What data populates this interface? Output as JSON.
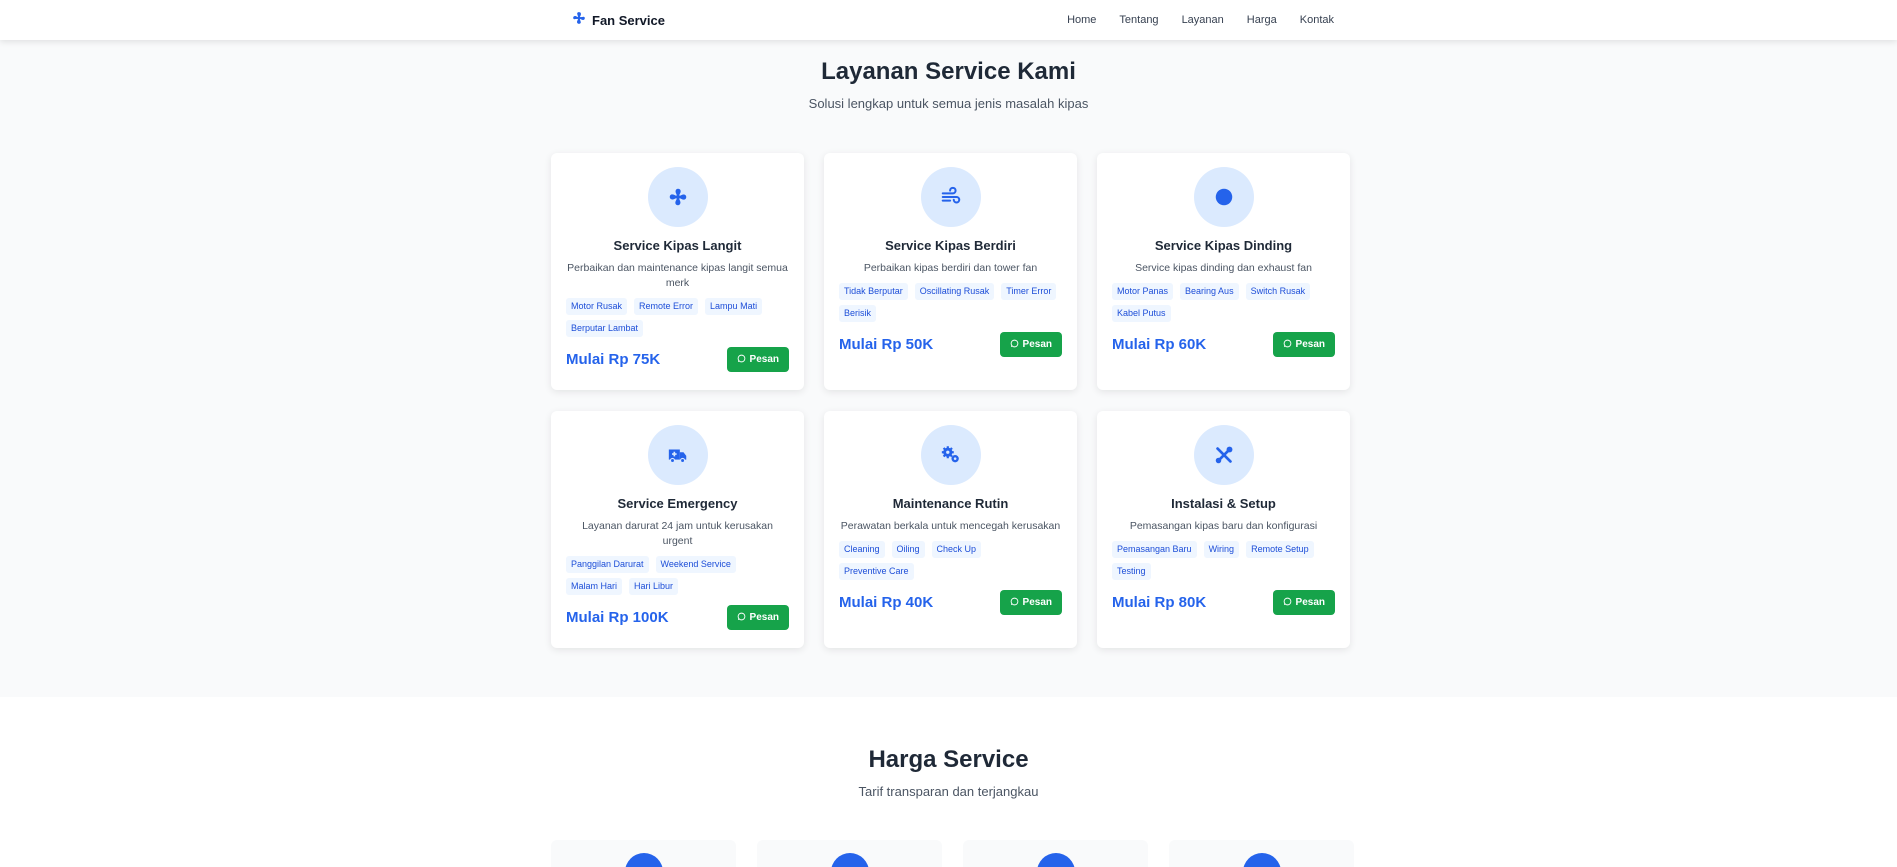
{
  "navbar": {
    "brand": "Fan Service",
    "brand_icon": "fan-icon",
    "links": [
      "Home",
      "Tentang",
      "Layanan",
      "Harga",
      "Kontak"
    ]
  },
  "services": {
    "title": "Layanan Service Kami",
    "subtitle": "Solusi lengkap untuk semua jenis masalah kipas",
    "cards": [
      {
        "icon": "fan-icon",
        "title": "Service Kipas Langit",
        "desc": "Perbaikan dan maintenance kipas langit semua merk",
        "tags": [
          "Motor Rusak",
          "Remote Error",
          "Lampu Mati",
          "Berputar Lambat"
        ],
        "price": "Mulai Rp 75K",
        "button": "Pesan"
      },
      {
        "icon": "wind-icon",
        "title": "Service Kipas Berdiri",
        "desc": "Perbaikan kipas berdiri dan tower fan",
        "tags": [
          "Tidak Berputar",
          "Oscillating Rusak",
          "Timer Error",
          "Berisik"
        ],
        "price": "Mulai Rp 50K",
        "button": "Pesan"
      },
      {
        "icon": "circle-icon",
        "title": "Service Kipas Dinding",
        "desc": "Service kipas dinding dan exhaust fan",
        "tags": [
          "Motor Panas",
          "Bearing Aus",
          "Switch Rusak",
          "Kabel Putus"
        ],
        "price": "Mulai Rp 60K",
        "button": "Pesan"
      },
      {
        "icon": "ambulance-icon",
        "title": "Service Emergency",
        "desc": "Layanan darurat 24 jam untuk kerusakan urgent",
        "tags": [
          "Panggilan Darurat",
          "Weekend Service",
          "Malam Hari",
          "Hari Libur"
        ],
        "price": "Mulai Rp 100K",
        "button": "Pesan"
      },
      {
        "icon": "gears-icon",
        "title": "Maintenance Rutin",
        "desc": "Perawatan berkala untuk mencegah kerusakan",
        "tags": [
          "Cleaning",
          "Oiling",
          "Check Up",
          "Preventive Care"
        ],
        "price": "Mulai Rp 40K",
        "button": "Pesan"
      },
      {
        "icon": "tools-icon",
        "title": "Instalasi & Setup",
        "desc": "Pemasangan kipas baru dan konfigurasi",
        "tags": [
          "Pemasangan Baru",
          "Wiring",
          "Remote Setup",
          "Testing"
        ],
        "price": "Mulai Rp 80K",
        "button": "Pesan"
      }
    ]
  },
  "pricing": {
    "title": "Harga Service",
    "subtitle": "Tarif transparan dan terjangkau"
  },
  "colors": {
    "primary": "#2563eb",
    "whatsapp_green": "#16a34a",
    "icon_bg": "#dbeafe"
  }
}
